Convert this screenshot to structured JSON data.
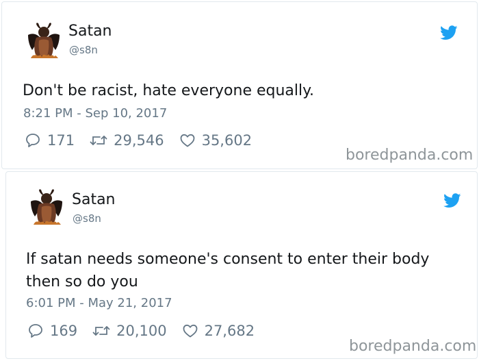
{
  "brand_color": "#1da1f2",
  "watermark": "boredpanda.com",
  "tweets": [
    {
      "display_name": "Satan",
      "handle": "@s8n",
      "text": "Don't be racist, hate everyone equally.",
      "timestamp": "8:21 PM - Sep 10, 2017",
      "replies": "171",
      "retweets": "29,546",
      "likes": "35,602"
    },
    {
      "display_name": "Satan",
      "handle": "@s8n",
      "text": "If satan needs someone's consent to enter their body then so do you",
      "timestamp": "6:01 PM - May 21, 2017",
      "replies": "169",
      "retweets": "20,100",
      "likes": "27,682"
    }
  ]
}
